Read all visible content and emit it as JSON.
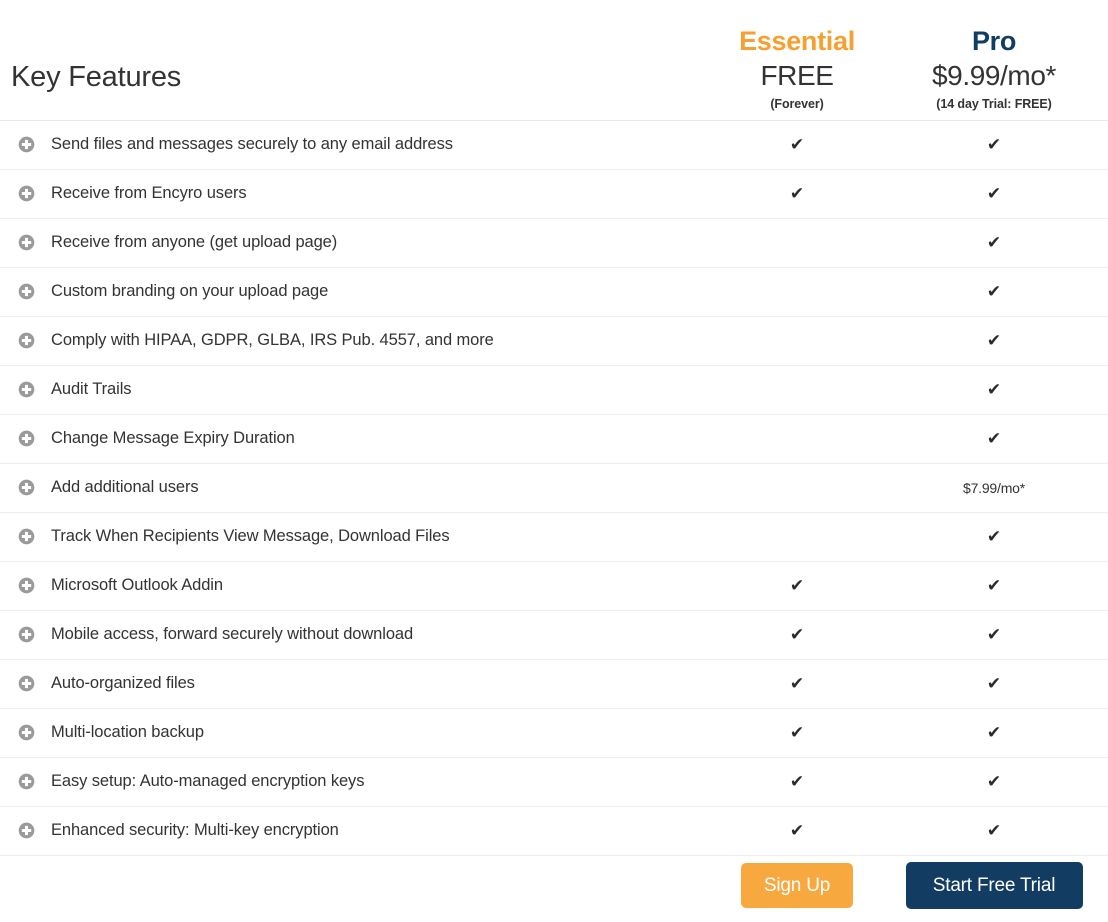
{
  "header": {
    "features_title": "Key Features",
    "plans": [
      {
        "name": "Essential",
        "price": "FREE",
        "note": "(Forever)",
        "color": "#f5a030"
      },
      {
        "name": "Pro",
        "price": "$9.99/mo*",
        "note": "(14 day Trial: FREE)",
        "color": "#123d63"
      }
    ]
  },
  "icons": {
    "plus": "plus-circle-icon",
    "check": "✔"
  },
  "rows": [
    {
      "label": "Send files and messages securely to any email address",
      "essential": "✔",
      "pro": "✔"
    },
    {
      "label": "Receive from Encyro users",
      "essential": "✔",
      "pro": "✔"
    },
    {
      "label": "Receive from anyone (get upload page)",
      "essential": "",
      "pro": "✔"
    },
    {
      "label": "Custom branding on your upload page",
      "essential": "",
      "pro": "✔"
    },
    {
      "label": "Comply with HIPAA, GDPR, GLBA, IRS Pub. 4557, and more",
      "essential": "",
      "pro": "✔"
    },
    {
      "label": "Audit Trails",
      "essential": "",
      "pro": "✔"
    },
    {
      "label": "Change Message Expiry Duration",
      "essential": "",
      "pro": "✔"
    },
    {
      "label": "Add additional users",
      "essential": "",
      "pro": "$7.99/mo*"
    },
    {
      "label": "Track When Recipients View Message, Download Files",
      "essential": "",
      "pro": "✔"
    },
    {
      "label": "Microsoft Outlook Addin",
      "essential": "✔",
      "pro": "✔"
    },
    {
      "label": "Mobile access, forward securely without download",
      "essential": "✔",
      "pro": "✔"
    },
    {
      "label": "Auto-organized files",
      "essential": "✔",
      "pro": "✔"
    },
    {
      "label": "Multi-location backup",
      "essential": "✔",
      "pro": "✔"
    },
    {
      "label": "Easy setup: Auto-managed encryption keys",
      "essential": "✔",
      "pro": "✔"
    },
    {
      "label": "Enhanced security: Multi-key encryption",
      "essential": "✔",
      "pro": "✔"
    }
  ],
  "footer": {
    "signup_label": "Sign Up",
    "trial_label": "Start Free Trial",
    "signup_color": "#f7a93f",
    "trial_color": "#133c63"
  }
}
